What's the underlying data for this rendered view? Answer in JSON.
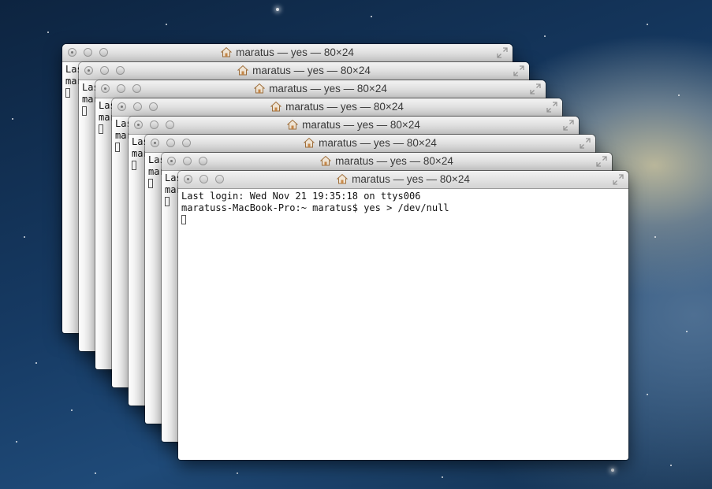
{
  "window": {
    "title": "maratus — yes — 80×24"
  },
  "terminal": {
    "last_login": "Last login: Wed Nov 21 19:35:18 on ttys006",
    "command_line": "maratuss-MacBook-Pro:~ maratus$ yes > /dev/null"
  },
  "behind_window": {
    "line1": "Las",
    "line2": "mar"
  },
  "icons": {
    "title_icon": "home-folder-icon",
    "close": "close-button",
    "minimize": "minimize-button",
    "zoom": "zoom-button",
    "resize": "fullscreen-arrows-icon"
  }
}
